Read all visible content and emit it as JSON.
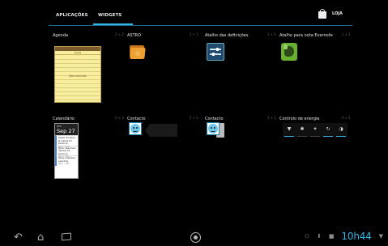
{
  "tabs": {
    "apps_label": "APLICAÇÕES",
    "widgets_label": "WIDGETS",
    "store_label": "LOJA"
  },
  "widgets": [
    {
      "title": "Agenda",
      "size": "2 x 2"
    },
    {
      "title": "ASTRO",
      "size": "1 x 1"
    },
    {
      "title": "Atalho das definições",
      "size": "1 x 1"
    },
    {
      "title": "Atalho para nota Evernote",
      "size": "1 x 1"
    },
    {
      "title": "Calendário",
      "size": "2 x 3"
    },
    {
      "title": "Contacto",
      "size": "2 x 1"
    },
    {
      "title": "Contacto",
      "size": "1 x 1"
    },
    {
      "title": "Controlo de energia",
      "size": "4 x 1"
    }
  ],
  "agenda_preview": {
    "header": "Sexta",
    "message": "Nos eventos"
  },
  "calendar_preview": {
    "weekday": "SEP",
    "date": "Sep 27",
    "events": [
      {
        "title": "Sales Cookies & Cakes for Science",
        "sub": "3pm – 5pm"
      },
      {
        "title": "Tutor teachers demos for Science",
        "sub": "3pm – 6pm"
      },
      {
        "title": "Shop member opening",
        "sub": "6pm – 9pm"
      }
    ]
  },
  "status": {
    "clock": "10h44"
  },
  "colors": {
    "accent": "#33b5e5"
  }
}
